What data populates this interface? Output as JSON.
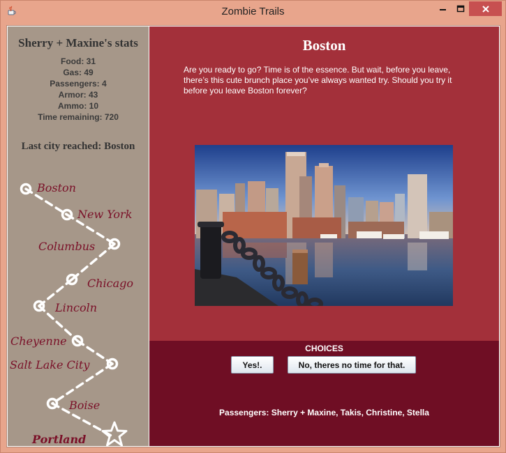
{
  "window": {
    "title": "Zombie Trails",
    "controls": {
      "minimize": "–",
      "maximize": "□",
      "close": "✕"
    },
    "app_icon": "java-cup-icon"
  },
  "sidebar": {
    "stats_title": "Sherry + Maxine's stats",
    "stats": [
      "Food: 31",
      "Gas: 49",
      "Passengers: 4",
      "Armor: 43",
      "Ammo: 10",
      "Time remaining: 720"
    ],
    "last_city": "Last city reached: Boston",
    "route_cities": [
      "Boston",
      "New York",
      "Columbus",
      "Chicago",
      "Lincoln",
      "Cheyenne",
      "Salt Lake City",
      "Boise",
      "Portland"
    ],
    "destination_icon": "star-icon",
    "node_icon": "circle-icon"
  },
  "main": {
    "city_title": "Boston",
    "story": "Are you ready to go? Time is of the essence. But wait, before you leave, there’s this cute brunch place you’ve always wanted try. Should you try it before you leave Boston forever?",
    "photo": "boston-harbor-skyline-photo"
  },
  "choices": {
    "title": "CHOICES",
    "yes_label": "Yes!.",
    "no_label": "No, theres no time for that.",
    "passengers": "Passengers: Sherry + Maxine, Takis, Christine, Stella"
  },
  "colors": {
    "sidebar_bg": "#a69789",
    "top_panel_bg": "#a3303a",
    "bottom_panel_bg": "#6f0e24",
    "city_label": "#7a1028",
    "title_bar": "#e8a58c"
  }
}
